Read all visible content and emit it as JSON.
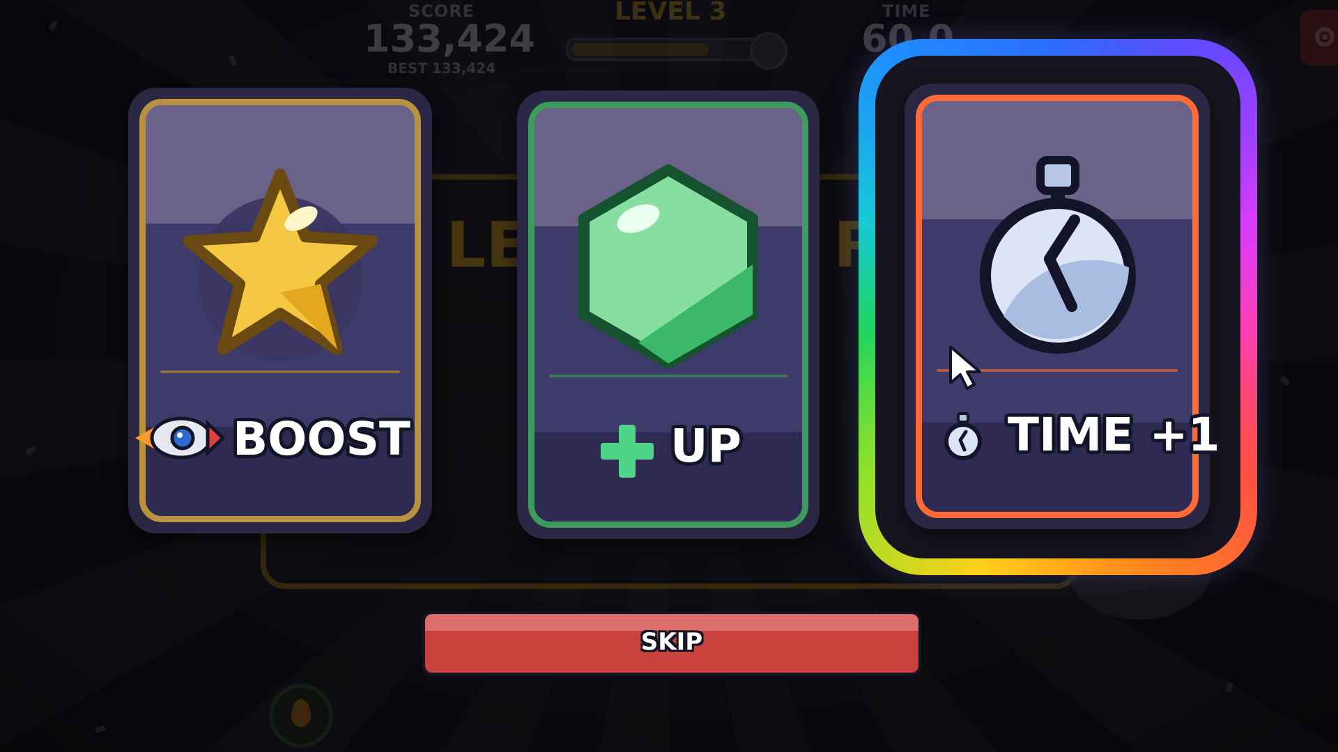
{
  "hud": {
    "score_label": "SCORE",
    "score_value": "133,424",
    "best_text": "BEST 133,424",
    "level_label": "LEVEL 3",
    "level_progress": 0.72,
    "time_label": "TIME",
    "time_value": "60.0",
    "settings_icon": "gear-icon"
  },
  "background_panel": {
    "title_left": "LE",
    "title_right": "R"
  },
  "cards": [
    {
      "id": "boost",
      "label": "BOOST",
      "border_color": "#b8923f",
      "icon": "star-icon",
      "label_icon": "rocket-icon"
    },
    {
      "id": "up",
      "label": "UP",
      "border_color": "#3f9a5e",
      "icon": "green-gem-icon",
      "label_icon": "plus-icon"
    },
    {
      "id": "time",
      "label": "TIME +1",
      "border_color": "#ff6a35",
      "icon": "stopwatch-icon",
      "label_icon": "stopwatch-icon",
      "highlighted": true
    }
  ],
  "skip_button": {
    "label": "SKIP",
    "color": "#c8413d"
  }
}
